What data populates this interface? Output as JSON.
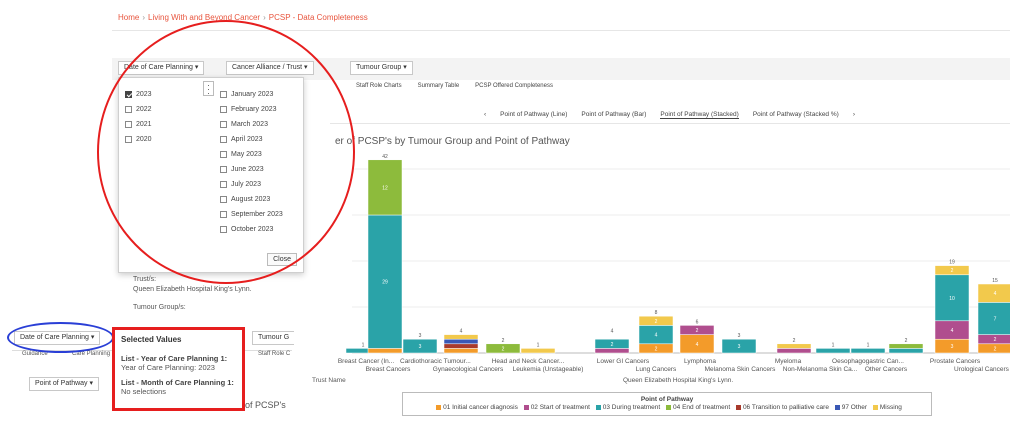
{
  "breadcrumb": {
    "home": "Home",
    "section": "Living With and Beyond Cancer",
    "page": "PCSP - Data Completeness"
  },
  "filters": {
    "date": "Date of Care Planning",
    "alliance": "Cancer Alliance / Trust",
    "tumour": "Tumour Group",
    "tumour_short": "Tumour G"
  },
  "tabs": [
    "Staff Role Charts",
    "Summary Table",
    "PCSP Offered Completeness"
  ],
  "left_tabs": {
    "guidance": "Guidance",
    "care": "Care Planning",
    "staff": "Staff Role C"
  },
  "point_button": "Point of Pathway",
  "dropdown": {
    "years": [
      {
        "label": "2023",
        "checked": true
      },
      {
        "label": "2022",
        "checked": false
      },
      {
        "label": "2021",
        "checked": false
      },
      {
        "label": "2020",
        "checked": false
      }
    ],
    "months": [
      "January 2023",
      "February 2023",
      "March 2023",
      "April 2023",
      "May 2023",
      "June 2023",
      "July 2023",
      "August 2023",
      "September 2023",
      "October 2023"
    ],
    "close": "Close"
  },
  "trust_label": "Trust/s:",
  "trust_value": "Queen Elizabeth Hospital King's Lynn.",
  "tumour_label": "Tumour Group/s:",
  "pathway_tabs": [
    "Point of Pathway (Line)",
    "Point of Pathway (Bar)",
    "Point of Pathway (Stacked)",
    "Point of Pathway (Stacked %)"
  ],
  "chart_title": "er of PCSP's by Tumour Group and Point of Pathway",
  "chart_title_small": "of PCSP's",
  "selected": {
    "heading": "Selected Values",
    "l1": "List - Year of Care Planning 1:",
    "v1": "Year of Care Planning: 2023",
    "l2": "List - Month of Care Planning 1:",
    "v2": "No selections"
  },
  "trust_name_label": "Trust Name",
  "trust_name_value": "Queen Elizabeth Hospital King's Lynn.",
  "colors": {
    "c01": "#f39b2a",
    "c02": "#b04e8e",
    "c03": "#2aa3a8",
    "c04": "#8dbb3c",
    "c06": "#a83a2c",
    "c97": "#3a58b5",
    "missing": "#f2c94c"
  },
  "chart_data": {
    "type": "bar",
    "stacked": true,
    "categories": [
      "Breast Cancer (In...",
      "Breast Cancers",
      "Cardiothoracic",
      "Gynaecological Cancers",
      "Head and Neck Cancer...",
      "Leukemia (Unstageable)",
      "Lower GI Cancers",
      "Lung Cancers",
      "Lymphoma",
      "Melanoma Skin Cancers",
      "Myeloma",
      "Non-Melanoma Skin Ca...",
      "Oesophagogastric Can...",
      "Other Cancers",
      "Prostate Cancers",
      "Urological Cancers"
    ],
    "series": [
      {
        "name": "01 Initial cancer diagnosis",
        "values": [
          0,
          1,
          0,
          1,
          0,
          0,
          0,
          2,
          4,
          0,
          0,
          0,
          0,
          0,
          3,
          2
        ]
      },
      {
        "name": "02 Start of treatment",
        "values": [
          0,
          0,
          0,
          0,
          0,
          0,
          1,
          0,
          2,
          0,
          1,
          0,
          0,
          0,
          4,
          2
        ]
      },
      {
        "name": "03 During treatment",
        "values": [
          1,
          29,
          3,
          0,
          0,
          0,
          2,
          4,
          0,
          3,
          0,
          1,
          1,
          1,
          10,
          7
        ]
      },
      {
        "name": "04 End of treatment",
        "values": [
          0,
          12,
          0,
          0,
          2,
          0,
          0,
          0,
          0,
          0,
          0,
          0,
          0,
          1,
          0,
          0
        ]
      },
      {
        "name": "06 Transition to palliative care",
        "values": [
          0,
          0,
          0,
          1,
          0,
          0,
          0,
          0,
          0,
          0,
          0,
          0,
          0,
          0,
          0,
          0
        ]
      },
      {
        "name": "97 Other",
        "values": [
          0,
          0,
          0,
          1,
          0,
          0,
          0,
          0,
          0,
          0,
          0,
          0,
          0,
          0,
          0,
          0
        ]
      },
      {
        "name": "Missing",
        "values": [
          0,
          0,
          0,
          1,
          0,
          1,
          0,
          2,
          0,
          0,
          1,
          0,
          0,
          0,
          2,
          4
        ]
      }
    ],
    "totals": [
      1,
      42,
      3,
      4,
      2,
      1,
      4,
      8,
      6,
      3,
      2,
      1,
      1,
      2,
      19,
      15
    ],
    "legend_title": "Point of Pathway",
    "legend_placement": "bottom"
  }
}
